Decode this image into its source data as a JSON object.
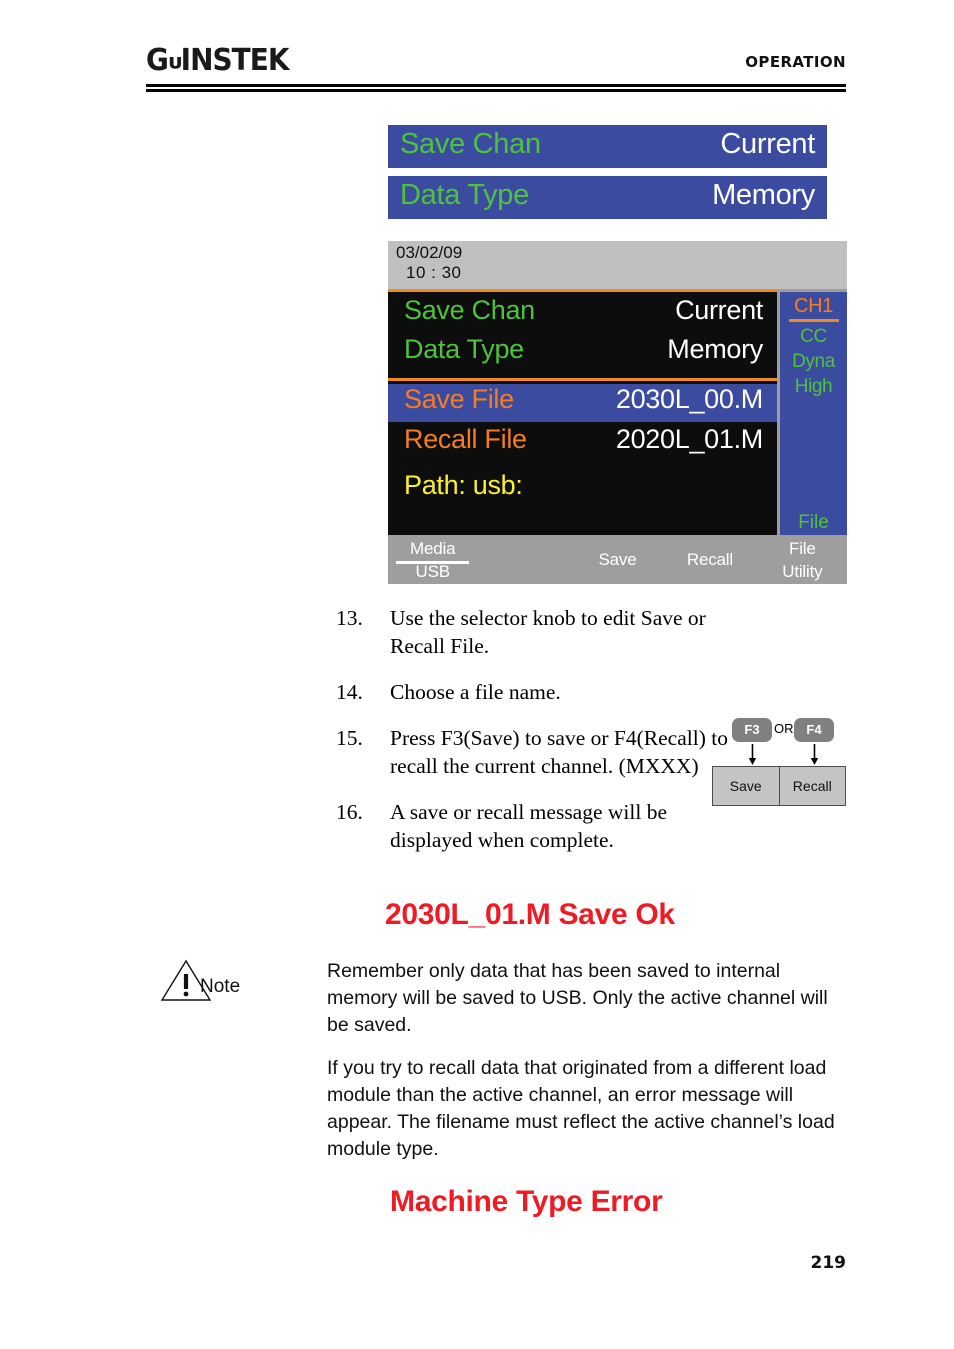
{
  "header": {
    "logo_gw": "G",
    "logo_u": "ᴜ",
    "logo_instek": "INSTEK",
    "title": "OPERATION"
  },
  "banners": [
    {
      "label": "Save Chan",
      "value": "Current"
    },
    {
      "label": "Data Type",
      "value": "Memory"
    }
  ],
  "lcd": {
    "date": "03/02/09",
    "time": "10 : 30",
    "rows_top": [
      {
        "label": "Save Chan",
        "value": "Current"
      },
      {
        "label": "Data Type",
        "value": "Memory"
      }
    ],
    "rows_bottom": [
      {
        "label": "Save File",
        "value": "2030L_00.M"
      },
      {
        "label": "Recall File",
        "value": "2020L_01.M"
      },
      {
        "label": "Path:  usb:",
        "value": ""
      }
    ],
    "sidebar": {
      "channel": "CH1",
      "items": [
        "CC",
        "Dyna",
        "High"
      ],
      "footer": "File"
    },
    "softkeys": [
      {
        "line1": "Media",
        "line2": "USB",
        "divider": true
      },
      {
        "line1": "",
        "line2": "",
        "divider": false
      },
      {
        "mid": "Save",
        "divider": false
      },
      {
        "mid": "Recall",
        "divider": false
      },
      {
        "line1": "File",
        "line2": "Utility",
        "divider": false
      }
    ]
  },
  "steps": [
    {
      "num": "13.",
      "text": "Use the selector knob to edit Save or Recall File."
    },
    {
      "num": "14.",
      "text": "Choose a file name."
    },
    {
      "num": "15.",
      "text": "Press F3(Save) to save or F4(Recall) to recall the current channel. (MXXX)"
    },
    {
      "num": "16.",
      "text": "A save or recall message will be displayed when complete."
    }
  ],
  "fkey_diagram": {
    "key_left": "F3",
    "or": "OR",
    "key_right": "F4",
    "box_left": "Save",
    "box_right": "Recall"
  },
  "messages": {
    "save_ok": "2030L_01.M Save Ok",
    "type_error": "Machine Type Error"
  },
  "note": {
    "label": "Note",
    "paragraph_1": "Remember only data that has been saved to internal memory will be saved to USB. Only the active channel will be saved.",
    "paragraph_2": "If you try to recall data that originated from a different load module than the active channel, an error message will appear. The filename must reflect the active channel’s load module type."
  },
  "footer": {
    "page_number": "219"
  },
  "colors": {
    "banner_blue": "#3b4ca0",
    "lcd_green": "#4ec23c",
    "lcd_orange": "#f57d20",
    "lcd_yellow": "#fdf22a",
    "alert_red": "#ed1c24",
    "lcd_black": "#0d0d0d",
    "softkey_gray": "#9e9e9e"
  }
}
